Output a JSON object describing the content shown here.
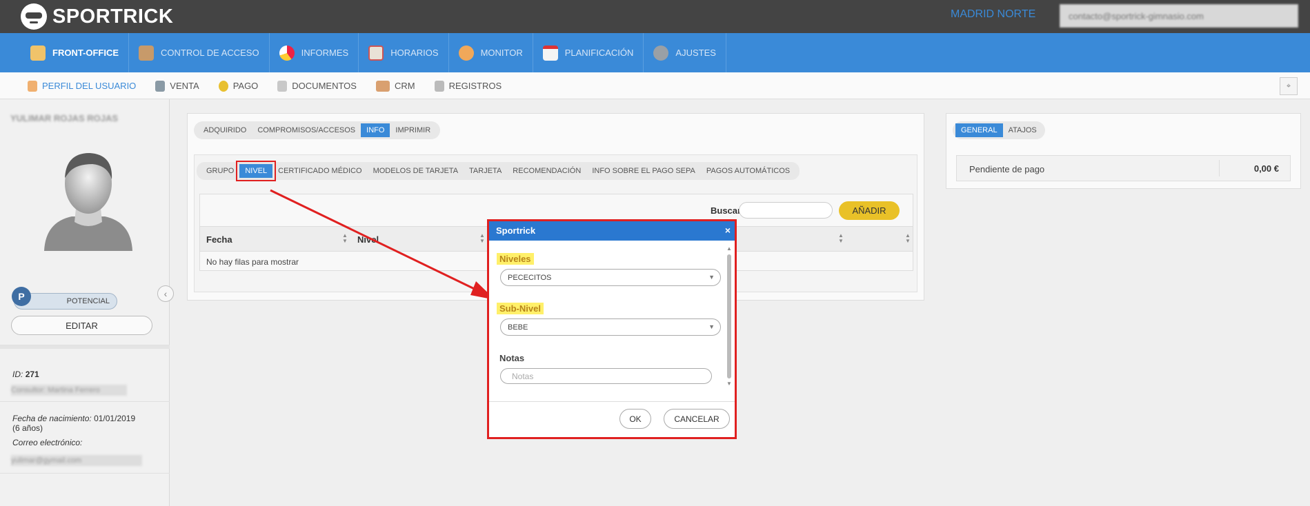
{
  "header": {
    "app_name": "SPORTRICK",
    "site_name": "MADRID NORTE",
    "user_email": "contacto@sportrick-gimnasio.com"
  },
  "main_nav": [
    {
      "label": "FRONT-OFFICE",
      "icon": "front-office-icon",
      "active": true
    },
    {
      "label": "CONTROL DE ACCESO",
      "icon": "access-control-icon"
    },
    {
      "label": "INFORMES",
      "icon": "pie-chart-icon"
    },
    {
      "label": "HORARIOS",
      "icon": "calendar-grid-icon"
    },
    {
      "label": "MONITOR",
      "icon": "people-icon"
    },
    {
      "label": "PLANIFICACIÓN",
      "icon": "calendar-icon"
    },
    {
      "label": "AJUSTES",
      "icon": "gear-icon"
    }
  ],
  "sub_nav": [
    {
      "label": "PERFIL DEL USUARIO",
      "active": true
    },
    {
      "label": "VENTA"
    },
    {
      "label": "PAGO"
    },
    {
      "label": "DOCUMENTOS"
    },
    {
      "label": "CRM"
    },
    {
      "label": "REGISTROS"
    }
  ],
  "sidebar": {
    "user_name": "YULIMAR ROJAS ROJAS",
    "status_badge": "P",
    "status_label": "POTENCIAL",
    "edit_label": "EDITAR",
    "id_label": "ID:",
    "id_value": "271",
    "consultant": "Consultor: Martina Ferrero",
    "birth_label": "Fecha de nacimiento:",
    "birth_value": "01/01/2019",
    "age": "(6 años)",
    "email_label": "Correo electrónico:",
    "email_value": "yulimar@gymail.com"
  },
  "panel": {
    "top_tabs": [
      "ADQUIRIDO",
      "COMPROMISOS/ACCESOS",
      "INFO",
      "IMPRIMIR"
    ],
    "top_active": "INFO",
    "sub_tabs": [
      "GRUPO",
      "NIVEL",
      "CERTIFICADO MÉDICO",
      "MODELOS DE TARJETA",
      "TARJETA",
      "RECOMENDACIÓN",
      "INFO SOBRE EL PAGO SEPA",
      "PAGOS AUTOMÁTICOS"
    ],
    "sub_active": "NIVEL",
    "search_label": "Buscar:",
    "add_label": "AÑADIR",
    "columns": [
      "Fecha",
      "Nivel"
    ],
    "empty_text": "No hay filas para mostrar"
  },
  "right_panel": {
    "tabs": [
      "GENERAL",
      "ATAJOS"
    ],
    "active": "GENERAL",
    "pending_label": "Pendiente de pago",
    "pending_value": "0,00 €"
  },
  "modal": {
    "title": "Sportrick",
    "close": "×",
    "niveles_label": "Niveles",
    "niveles_value": "PECECITOS",
    "subnivel_label": "Sub-Nivel",
    "subnivel_value": "BEBE",
    "notas_label": "Notas",
    "notas_placeholder": "Notas",
    "ok_label": "OK",
    "cancel_label": "CANCELAR"
  },
  "colors": {
    "brand_blue": "#3a8ad8",
    "topbar": "#444444",
    "highlight_red": "#e02020",
    "add_button": "#e9c128"
  }
}
